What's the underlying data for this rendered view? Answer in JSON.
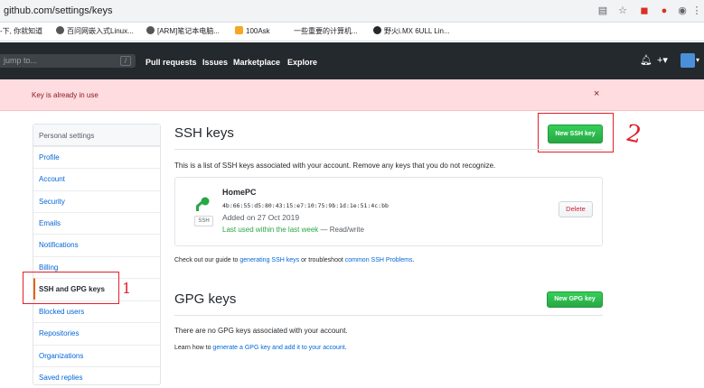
{
  "browser": {
    "url": "github.com/settings/keys",
    "bookmarks": [
      "-下, 你就知道",
      "百问网嵌入式Linux...",
      "[ARM]笔记本电脑...",
      "100Ask",
      "一些重要的计算机...",
      "野火i.MX 6ULL Lin..."
    ],
    "colors": {
      "accent": "#1a73e8"
    }
  },
  "header": {
    "search_placeholder": "jump to...",
    "slash_hint": "/",
    "nav": [
      "Pull requests",
      "Issues",
      "Marketplace",
      "Explore"
    ],
    "icons": [
      "bell-icon",
      "plus-icon",
      "avatar"
    ]
  },
  "flash": {
    "message": "Key is already in use",
    "close": "×"
  },
  "sidebar": {
    "heading": "Personal settings",
    "items": [
      {
        "label": "Profile"
      },
      {
        "label": "Account"
      },
      {
        "label": "Security"
      },
      {
        "label": "Emails"
      },
      {
        "label": "Notifications"
      },
      {
        "label": "Billing"
      },
      {
        "label": "SSH and GPG keys",
        "selected": true
      },
      {
        "label": "Blocked users"
      },
      {
        "label": "Repositories"
      },
      {
        "label": "Organizations"
      },
      {
        "label": "Saved replies"
      }
    ]
  },
  "ssh": {
    "title": "SSH keys",
    "new_button": "New SSH key",
    "description": "This is a list of SSH keys associated with your account. Remove any keys that you do not recognize.",
    "key": {
      "title": "HomePC",
      "fingerprint": "4b:66:55:d5:80:43:15:e7:10:75:9b:1d:1e:51:4c:bb",
      "badge": "SSH",
      "added": "Added on 27 Oct 2019",
      "used_green": "Last used within the last week",
      "used_rest": " — Read/write",
      "delete_label": "Delete"
    },
    "guide_prefix": "Check out our guide to ",
    "guide_link1": "generating SSH keys",
    "guide_mid": " or troubleshoot ",
    "guide_link2": "common SSH Problems",
    "guide_suffix": "."
  },
  "gpg": {
    "title": "GPG keys",
    "new_button": "New GPG key",
    "empty": "There are no GPG keys associated with your account.",
    "learn_prefix": "Learn how to ",
    "learn_link": "generate a GPG key and add it to your account",
    "learn_suffix": "."
  },
  "annotations": {
    "mark1": "1",
    "mark2": "2"
  }
}
